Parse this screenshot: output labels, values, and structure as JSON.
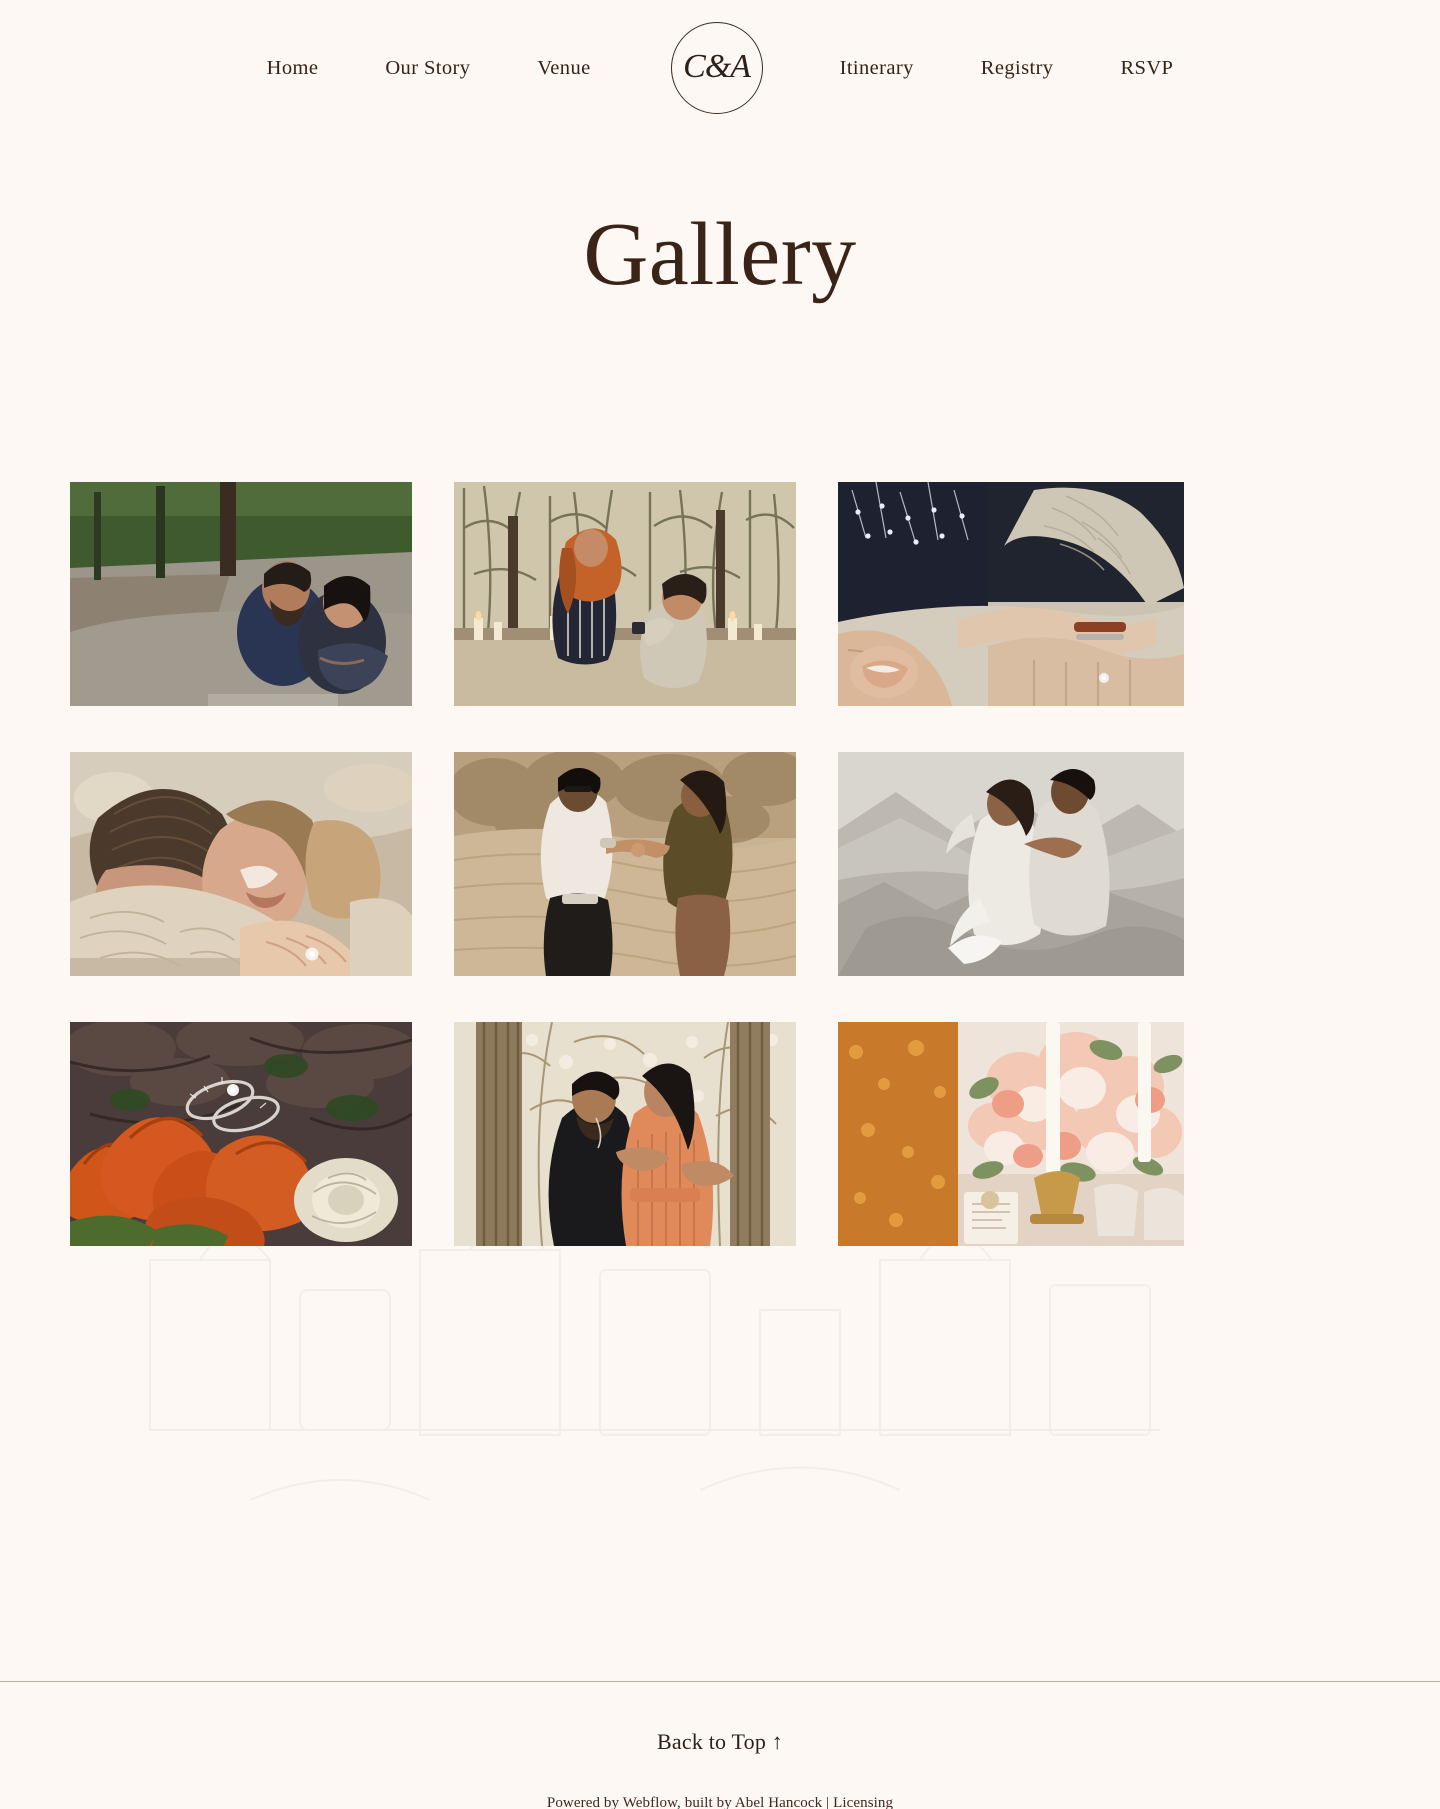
{
  "theme": {
    "background": "#FDF8F3",
    "text": "#3B2A20",
    "heading": "#3A2418",
    "rule": "#B7ADA3"
  },
  "nav": {
    "logo": {
      "monogram": "C&A",
      "icon": "monogram-circle-icon"
    },
    "left_links": [
      {
        "label": "Home"
      },
      {
        "label": "Our Story"
      },
      {
        "label": "Venue"
      }
    ],
    "right_links": [
      {
        "label": "Itinerary"
      },
      {
        "label": "Registry"
      },
      {
        "label": "RSVP"
      }
    ]
  },
  "main": {
    "title": "Gallery",
    "gallery": {
      "rows": [
        [
          {
            "alt": "Couple sitting together on a paved path surrounded by green trees",
            "scene": "path-couple",
            "colors": {
              "sky": "#cfd6c3",
              "foliage": "#3f5a2e",
              "ground": "#8e8a80",
              "accent": "#2a3553"
            }
          },
          {
            "alt": "Marriage proposal on a candlelit patio among bare spring trees",
            "scene": "proposal-patio",
            "colors": {
              "sky": "#e8e2d4",
              "foliage": "#6d6b50",
              "ground": "#b6ab93",
              "accent": "#1f2330"
            }
          },
          {
            "alt": "Close-up of a laughing woman's hands wearing an engagement ring on a knit sweater",
            "scene": "hands-ring-sweater",
            "colors": {
              "sky": "#cbc2b2",
              "foliage": "#20242f",
              "ground": "#d8d0c2",
              "accent": "#8c3a2e"
            }
          }
        ],
        [
          {
            "alt": "Couple embracing cheek to cheek in cream knit sweaters at golden hour",
            "scene": "embrace-sweaters",
            "colors": {
              "sky": "#d8cdbd",
              "foliage": "#7c6a55",
              "ground": "#cdbfae",
              "accent": "#45372c"
            }
          },
          {
            "alt": "Couple holding hands walking across a dry desert hillside",
            "scene": "desert-hands",
            "colors": {
              "sky": "#d7c6ad",
              "foliage": "#a4896a",
              "ground": "#c9b395",
              "accent": "#5e4a2e"
            }
          },
          {
            "alt": "Bride and groom in pale outfits on a misty mountain ridge",
            "scene": "mountain-couple",
            "colors": {
              "sky": "#d6d2cb",
              "foliage": "#a9a49b",
              "ground": "#c2bdb4",
              "accent": "#efeee9"
            }
          }
        ],
        [
          {
            "alt": "Engagement rings resting on orange tulips with a white rose",
            "scene": "rings-tulips",
            "colors": {
              "sky": "#4a3c3a",
              "foliage": "#3b4a2b",
              "ground": "#6b5a52",
              "accent": "#d4581f"
            }
          },
          {
            "alt": "Couple standing forehead to forehead between trees in a sunlit grove",
            "scene": "grove-couple",
            "colors": {
              "sky": "#efe8d9",
              "foliage": "#8b7a5c",
              "ground": "#b9a886",
              "accent": "#e08a5c"
            }
          },
          {
            "alt": "Reception table with blush floral centerpiece, tapered candles and glassware",
            "scene": "reception-flowers",
            "colors": {
              "sky": "#efe2da",
              "foliage": "#7d9260",
              "ground": "#d8c6b6",
              "accent": "#f0a58f"
            }
          }
        ]
      ]
    }
  },
  "footer": {
    "back_to_top": "Back to Top ↑",
    "colophon": {
      "prefix": "Powered by ",
      "platform": "Webflow",
      "middle": ", built by ",
      "author": "Abel Hancock",
      "separator": " | ",
      "licensing": "Licensing"
    }
  }
}
